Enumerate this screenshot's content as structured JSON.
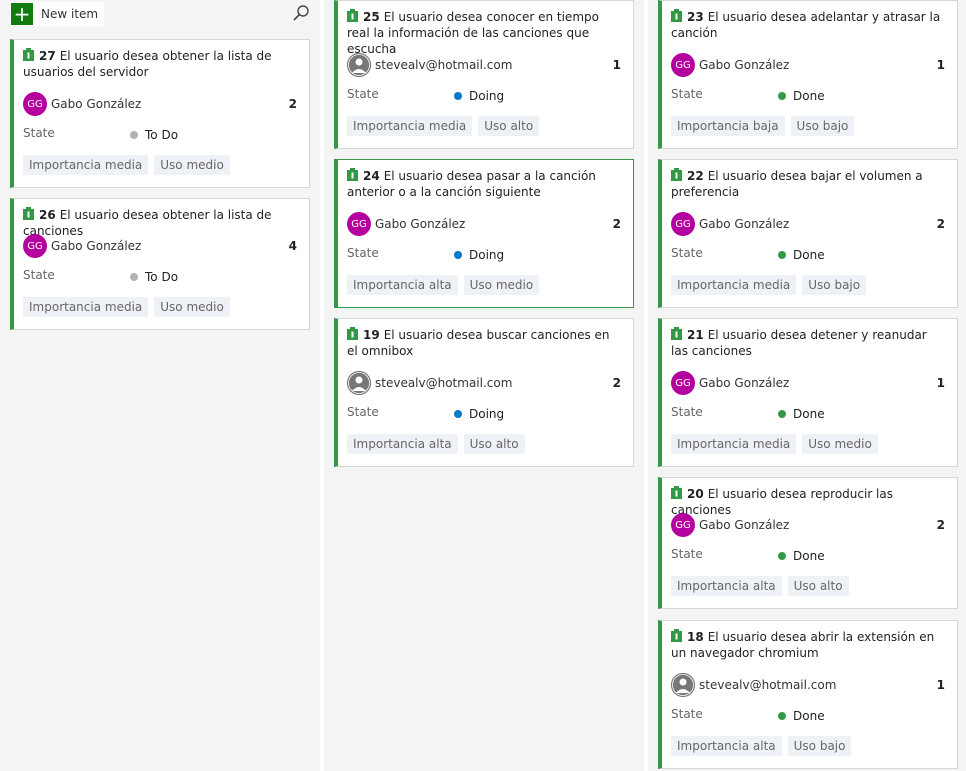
{
  "toolbar": {
    "new_item_label": "New item",
    "plus_icon": "+"
  },
  "cards": [
    {
      "id": "27",
      "title": "El usuario desea obtener la lista de usuarios del servidor",
      "assignee": "Gabo González",
      "initials": "GG",
      "effort": "2",
      "state_label": "State",
      "state": "To Do",
      "tags": [
        "Importancia media",
        "Uso medio"
      ]
    },
    {
      "id": "26",
      "title": "El usuario desea obtener la lista de canciones",
      "assignee": "Gabo González",
      "initials": "GG",
      "effort": "4",
      "state_label": "State",
      "state": "To Do",
      "tags": [
        "Importancia media",
        "Uso medio"
      ]
    },
    {
      "id": "25",
      "title": "El usuario desea conocer en tiempo real la información de las canciones que escucha",
      "assignee": "stevealv@hotmail.com",
      "initials": "",
      "effort": "1",
      "state_label": "State",
      "state": "Doing",
      "tags": [
        "Importancia media",
        "Uso alto"
      ]
    },
    {
      "id": "24",
      "title": "El usuario desea pasar a la canción anterior o a la canción siguiente",
      "assignee": "Gabo González",
      "initials": "GG",
      "effort": "2",
      "state_label": "State",
      "state": "Doing",
      "tags": [
        "Importancia alta",
        "Uso medio"
      ]
    },
    {
      "id": "19",
      "title": "El usuario desea buscar canciones en el omnibox",
      "assignee": "stevealv@hotmail.com",
      "initials": "",
      "effort": "2",
      "state_label": "State",
      "state": "Doing",
      "tags": [
        "Importancia alta",
        "Uso alto"
      ]
    },
    {
      "id": "23",
      "title": "El usuario desea adelantar y atrasar la canción",
      "assignee": "Gabo González",
      "initials": "GG",
      "effort": "1",
      "state_label": "State",
      "state": "Done",
      "tags": [
        "Importancia baja",
        "Uso bajo"
      ]
    },
    {
      "id": "22",
      "title": "El usuario desea bajar el volumen a preferencia",
      "assignee": "Gabo González",
      "initials": "GG",
      "effort": "2",
      "state_label": "State",
      "state": "Done",
      "tags": [
        "Importancia media",
        "Uso bajo"
      ]
    },
    {
      "id": "21",
      "title": "El usuario desea detener y reanudar las canciones",
      "assignee": "Gabo González",
      "initials": "GG",
      "effort": "1",
      "state_label": "State",
      "state": "Done",
      "tags": [
        "Importancia media",
        "Uso medio"
      ]
    },
    {
      "id": "20",
      "title": "El usuario desea reproducir las canciones",
      "assignee": "Gabo González",
      "initials": "GG",
      "effort": "2",
      "state_label": "State",
      "state": "Done",
      "tags": [
        "Importancia alta",
        "Uso alto"
      ]
    },
    {
      "id": "18",
      "title": "El usuario desea abrir la extensión en un navegador chromium",
      "assignee": "stevealv@hotmail.com",
      "initials": "",
      "effort": "1",
      "state_label": "State",
      "state": "Done",
      "tags": [
        "Importancia alta",
        "Uso bajo"
      ]
    }
  ],
  "colors": {
    "card_accent": "#339947",
    "todo": "#b2b2b2",
    "doing": "#007acc",
    "done": "#339947",
    "avatar": "#b4009e",
    "new_item": "#107c10"
  }
}
